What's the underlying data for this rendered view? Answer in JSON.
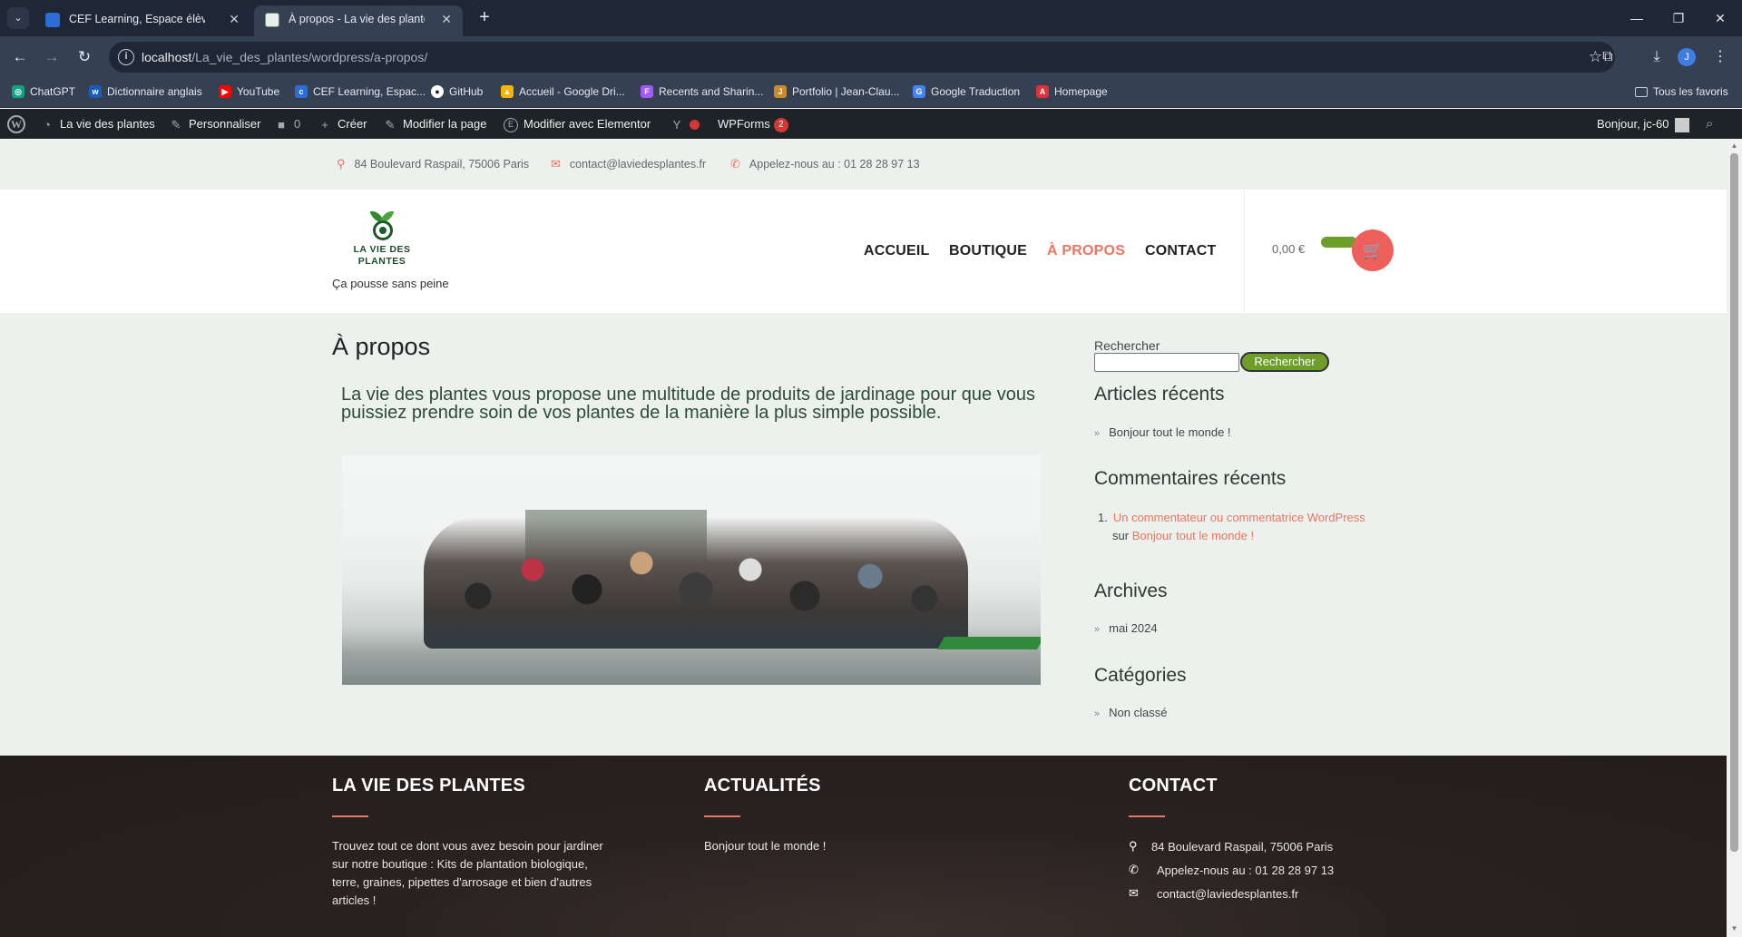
{
  "browser": {
    "tabs": [
      {
        "title": "CEF Learning, Espace élève du C",
        "close": "✕"
      },
      {
        "title": "À propos - La vie des plantes",
        "close": "✕"
      }
    ],
    "url_host": "localhost",
    "url_path": "/La_vie_des_plantes/wordpress/a-propos/",
    "profile_initial": "J",
    "bookmarks": [
      {
        "label": "ChatGPT",
        "color": "#10a37f"
      },
      {
        "label": "Dictionnaire anglais",
        "color": "#1c5cb8"
      },
      {
        "label": "YouTube",
        "color": "#ff0000"
      },
      {
        "label": "CEF Learning, Espac...",
        "color": "#2b6fd6"
      },
      {
        "label": "GitHub",
        "color": "#ffffff"
      },
      {
        "label": "Accueil - Google Dri...",
        "color": "#f4b400"
      },
      {
        "label": "Recents and Sharin...",
        "color": "#a259ff"
      },
      {
        "label": "Portfolio | Jean-Clau...",
        "color": "#c98a2b"
      },
      {
        "label": "Google Traduction",
        "color": "#4285f4"
      },
      {
        "label": "Homepage",
        "color": "#e0313a"
      }
    ],
    "all_bookmarks": "Tous les favoris"
  },
  "wp_admin": {
    "site_name": "La vie des plantes",
    "customize": "Personnaliser",
    "comments_count": "0",
    "new": "Créer",
    "edit_page": "Modifier la page",
    "elementor": "Modifier avec Elementor",
    "wpforms": "WPForms",
    "wpforms_badge": "2",
    "greeting": "Bonjour, jc-60"
  },
  "site": {
    "topbar": {
      "address": "84 Boulevard Raspail, 75006 Paris",
      "email": "contact@laviedesplantes.fr",
      "phone": "Appelez-nous au : 01 28 28 97 13"
    },
    "logo_line1": "LA VIE DES",
    "logo_line2": "PLANTES",
    "tagline": "Ça pousse sans peine",
    "nav": [
      "ACCUEIL",
      "BOUTIQUE",
      "À PROPOS",
      "CONTACT"
    ],
    "cart_amount": "0,00 €",
    "accent_color": "#ea7561",
    "green_color": "#6e9e2a"
  },
  "content": {
    "title": "À propos",
    "intro": "La vie des plantes vous propose une multitude de produits de jardinage pour que vous puissiez prendre soin de vos plantes de la manière la plus simple possible."
  },
  "sidebar": {
    "search_label": "Rechercher",
    "search_button": "Rechercher",
    "recent_posts_title": "Articles récents",
    "recent_posts": [
      "Bonjour tout le monde !"
    ],
    "recent_comments_title": "Commentaires récents",
    "comment_author": "Un commentateur ou commentatrice WordPress",
    "comment_on": "sur",
    "comment_post": "Bonjour tout le monde !",
    "archives_title": "Archives",
    "archives": [
      "mai 2024"
    ],
    "categories_title": "Catégories",
    "categories": [
      "Non classé"
    ]
  },
  "footer": {
    "col1_title": "LA VIE DES PLANTES",
    "col1_text": "Trouvez tout ce dont vous avez besoin pour jardiner sur notre boutique : Kits de plantation biologique, terre, graines, pipettes d'arrosage et bien d'autres articles !",
    "col2_title": "ACTUALITÉS",
    "col2_post": "Bonjour tout le monde !",
    "col3_title": "CONTACT",
    "address": "84 Boulevard Raspail, 75006 Paris",
    "phone": "Appelez-nous au : 01 28 28 97 13",
    "email": "contact@laviedesplantes.fr"
  }
}
